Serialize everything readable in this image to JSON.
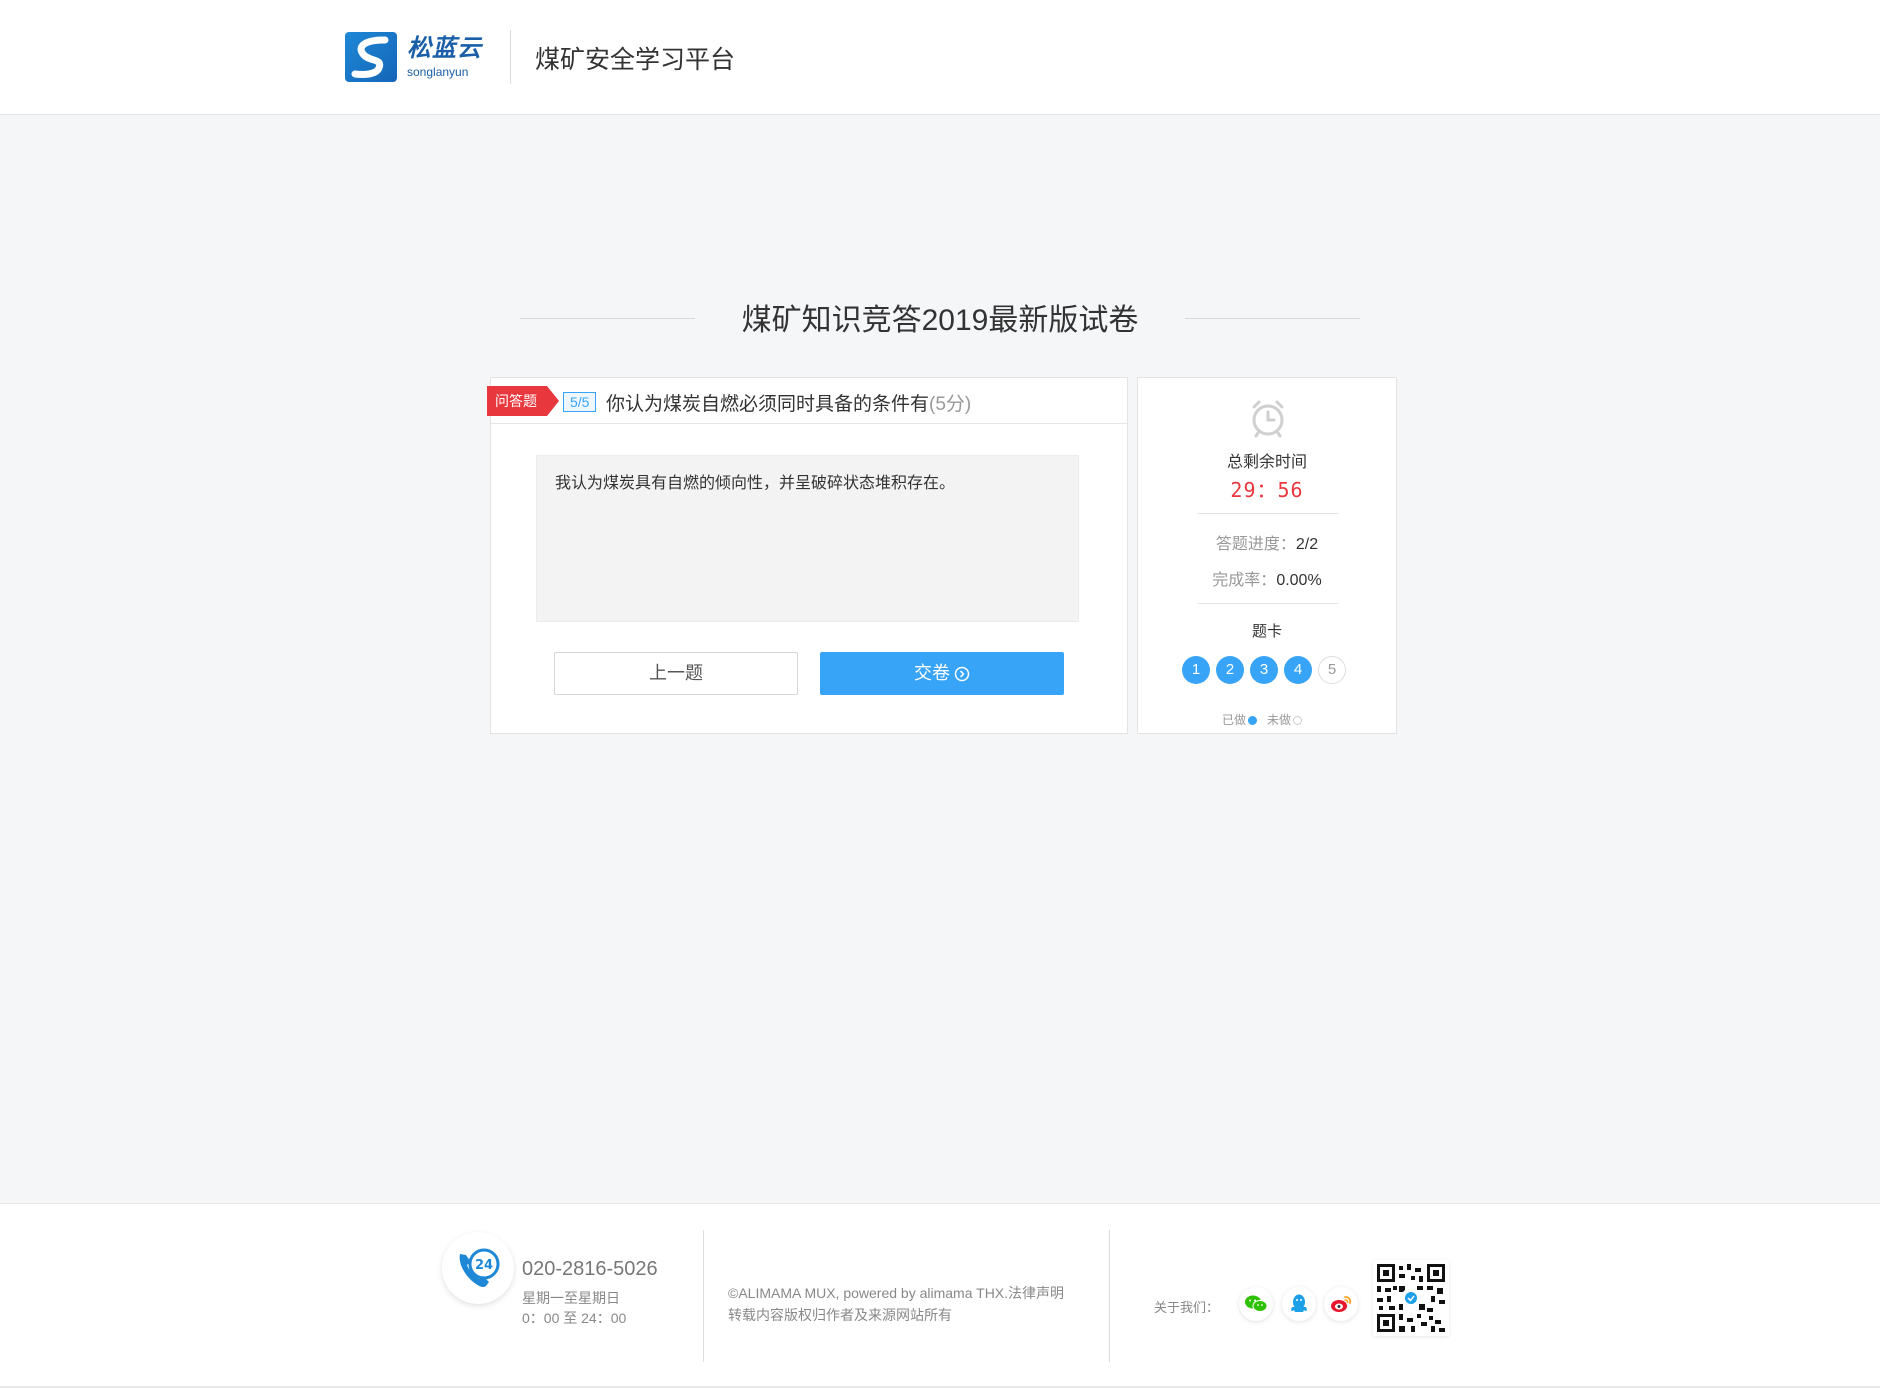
{
  "header": {
    "logo_cn": "松蓝云",
    "logo_en": "songlanyun",
    "platform_name": "煤矿安全学习平台"
  },
  "exam": {
    "title": "煤矿知识竞答2019最新版试卷"
  },
  "question": {
    "type_label": "问答题",
    "index": "5/5",
    "text": "你认为煤炭自燃必须同时具备的条件有",
    "score": "(5分)",
    "answer": "我认为煤炭具有自燃的倾向性，并呈破碎状态堆积存在。",
    "prev_label": "上一题",
    "submit_label": "交卷"
  },
  "side": {
    "time_label": "总剩余时间",
    "time_value": "29：56",
    "progress_key": "答题进度：",
    "progress_val": "2/2",
    "rate_key": "完成率：",
    "rate_val": "0.00%",
    "card_label": "题卡",
    "numbers": [
      {
        "label": "1",
        "state": "done"
      },
      {
        "label": "2",
        "state": "done"
      },
      {
        "label": "3",
        "state": "done"
      },
      {
        "label": "4",
        "state": "done"
      },
      {
        "label": "5",
        "state": "todo"
      }
    ],
    "legend_done": "已做",
    "legend_todo": "未做"
  },
  "footer": {
    "phone_badge_text": "24",
    "phone": "020-2816-5026",
    "service_days": "星期一至星期日",
    "service_hours": "0：00 至 24：00",
    "copyright": "©ALIMAMA MUX, powered by alimama THX.法律声明",
    "copyright_note": "转载内容版权归作者及来源网站所有",
    "about_label": "关于我们："
  },
  "colors": {
    "accent": "#38a4f8",
    "danger": "#e8383d",
    "page_bg": "#f5f6f8"
  }
}
